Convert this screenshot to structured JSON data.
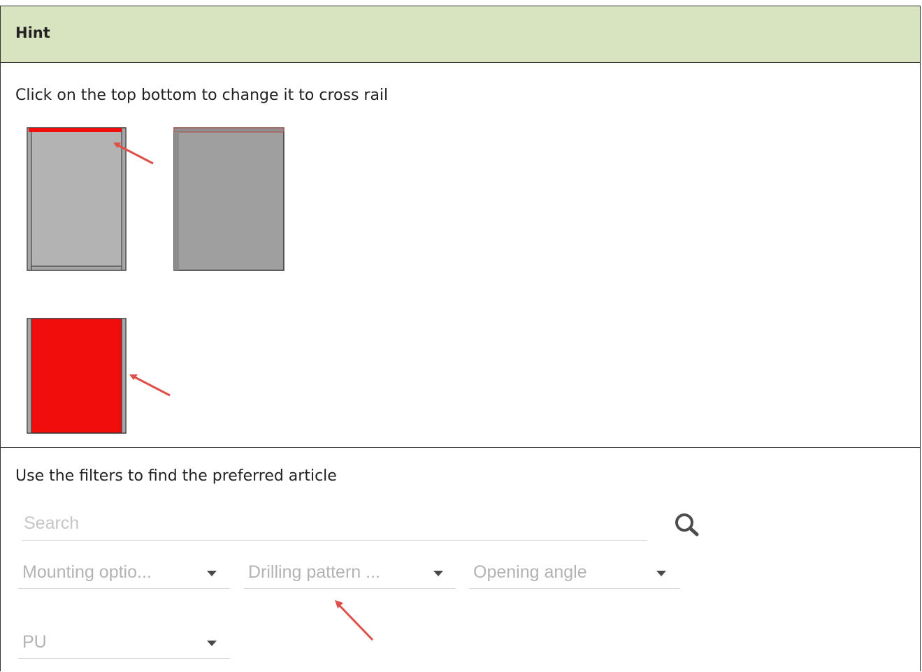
{
  "hint": {
    "title": "Hint"
  },
  "section1": {
    "instruction": "Click on the top bottom to change it to cross rail"
  },
  "section2": {
    "instruction": "Use the filters to find the preferred article",
    "search": {
      "placeholder": "Search",
      "icon": "search-icon"
    },
    "filters": [
      {
        "label": "Mounting optio...",
        "icon": "caret-down-icon"
      },
      {
        "label": "Drilling pattern ...",
        "icon": "caret-down-icon"
      },
      {
        "label": "Opening angle",
        "icon": "caret-down-icon"
      },
      {
        "label": "PU",
        "icon": "caret-down-icon"
      }
    ]
  },
  "colors": {
    "header_bg": "#d8e3bf",
    "highlight_red": "#f20d0d",
    "arrow_red": "#e0504a",
    "cabinet_gray": "#b3b3b3",
    "cabinet_dark_gray": "#9f9f9f"
  }
}
